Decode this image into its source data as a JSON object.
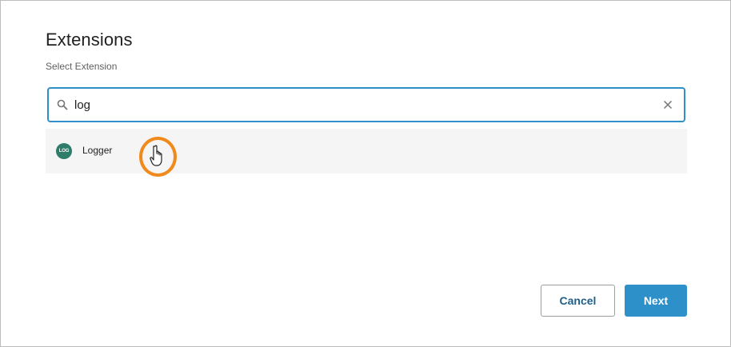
{
  "dialog": {
    "title": "Extensions",
    "subtitle": "Select Extension"
  },
  "search": {
    "value": "log",
    "placeholder": "",
    "icon": "search-icon",
    "clear_icon": "close-icon",
    "accent_color": "#2e90c8"
  },
  "results": [
    {
      "badge": "LOG",
      "name": "Logger",
      "badge_color": "#2e7d6b"
    }
  ],
  "buttons": {
    "cancel_label": "Cancel",
    "next_label": "Next"
  },
  "colors": {
    "primary": "#2e90c8",
    "cursor_highlight": "#f08a1c"
  }
}
